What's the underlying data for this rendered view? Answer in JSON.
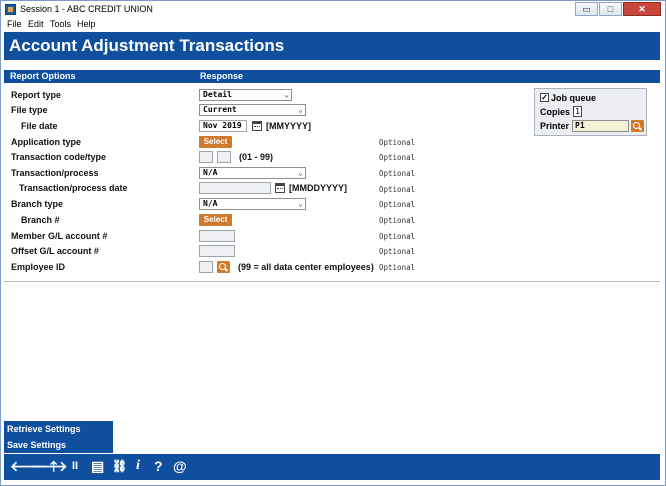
{
  "window": {
    "title": "Session 1 - ABC CREDIT UNION",
    "minimize_glyph": "▭",
    "restore_glyph": "□",
    "close_glyph": "✕"
  },
  "menu": [
    "File",
    "Edit",
    "Tools",
    "Help"
  ],
  "header": {
    "title": "Account Adjustment Transactions"
  },
  "section": {
    "left": "Report Options",
    "right": "Response"
  },
  "fields": {
    "report_type": {
      "label": "Report type",
      "value": "Detail"
    },
    "file_type": {
      "label": "File type",
      "value": "Current"
    },
    "file_date": {
      "label": "File date",
      "value": "Nov 2019",
      "format": "[MMYYYY]"
    },
    "application_type": {
      "label": "Application type",
      "button": "Select",
      "optional": "Optional"
    },
    "transaction_code": {
      "label": "Transaction code/type",
      "range": "(01 - 99)",
      "optional": "Optional"
    },
    "transaction_process": {
      "label": "Transaction/process",
      "value": "N/A",
      "optional": "Optional"
    },
    "transaction_process_date": {
      "label": "Transaction/process date",
      "format": "[MMDDYYYY]",
      "optional": "Optional"
    },
    "branch_type": {
      "label": "Branch type",
      "value": "N/A",
      "optional": "Optional"
    },
    "branch_num": {
      "label": "Branch #",
      "button": "Select",
      "optional": "Optional"
    },
    "member_gl": {
      "label": "Member G/L account #",
      "optional": "Optional"
    },
    "offset_gl": {
      "label": "Offset G/L account #",
      "optional": "Optional"
    },
    "employee_id": {
      "label": "Employee ID",
      "hint": "(99 = all data center employees)",
      "optional": "Optional"
    }
  },
  "job_panel": {
    "job_queue_label": "Job queue",
    "job_queue_checked": true,
    "check_glyph": "✓",
    "copies_label": "Copies",
    "copies_value": "1",
    "printer_label": "Printer",
    "printer_value": "P1"
  },
  "side_buttons": [
    "Retrieve Settings",
    "Save Settings"
  ],
  "footer_icons": {
    "back": "🡐",
    "forward": "🡒",
    "up": "🡑",
    "pause": "II",
    "print": "▤",
    "link": "⛓",
    "info": "i",
    "help": "?",
    "email": "@"
  },
  "colors": {
    "brand_blue": "#0f4f9d",
    "action_orange": "#d07a2c"
  }
}
